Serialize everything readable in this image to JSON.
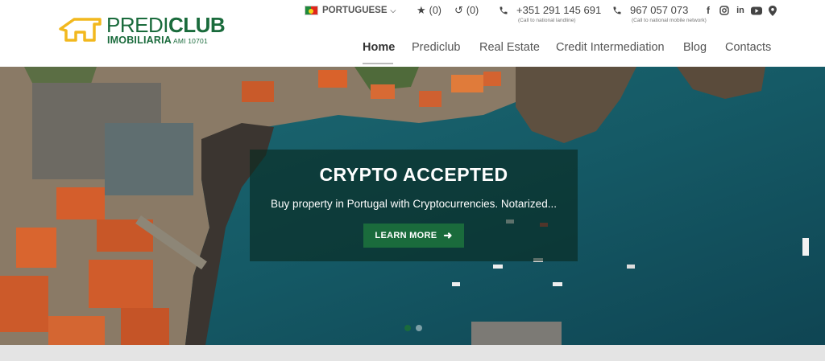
{
  "logo": {
    "name_part1": "PREDI",
    "name_part2": "CLUB",
    "subtitle": "IMOBILIARIA",
    "license": "AMI 10701",
    "brand_color": "#1a6b3c"
  },
  "topbar": {
    "language": "PORTUGUESE",
    "favorites_count": "(0)",
    "history_count": "(0)",
    "phone_landline": "+351 291 145 691",
    "phone_landline_note": "(Call to national landline)",
    "phone_mobile": "967 057 073",
    "phone_mobile_note": "(Call to national mobile network)",
    "social_icons": [
      "facebook-icon",
      "instagram-icon",
      "linkedin-icon",
      "youtube-icon",
      "location-icon"
    ]
  },
  "nav": {
    "items": [
      {
        "label": "Home",
        "active": true
      },
      {
        "label": "Prediclub",
        "active": false
      },
      {
        "label": "Real Estate",
        "active": false
      },
      {
        "label": "Credit Intermediation",
        "active": false
      },
      {
        "label": "Blog",
        "active": false
      },
      {
        "label": "Contacts",
        "active": false
      }
    ]
  },
  "hero": {
    "title": "CRYPTO ACCEPTED",
    "text": "Buy property in Portugal with Cryptocurrencies. Notarized...",
    "button_label": "LEARN MORE",
    "slides": 2,
    "active_slide": 1
  }
}
